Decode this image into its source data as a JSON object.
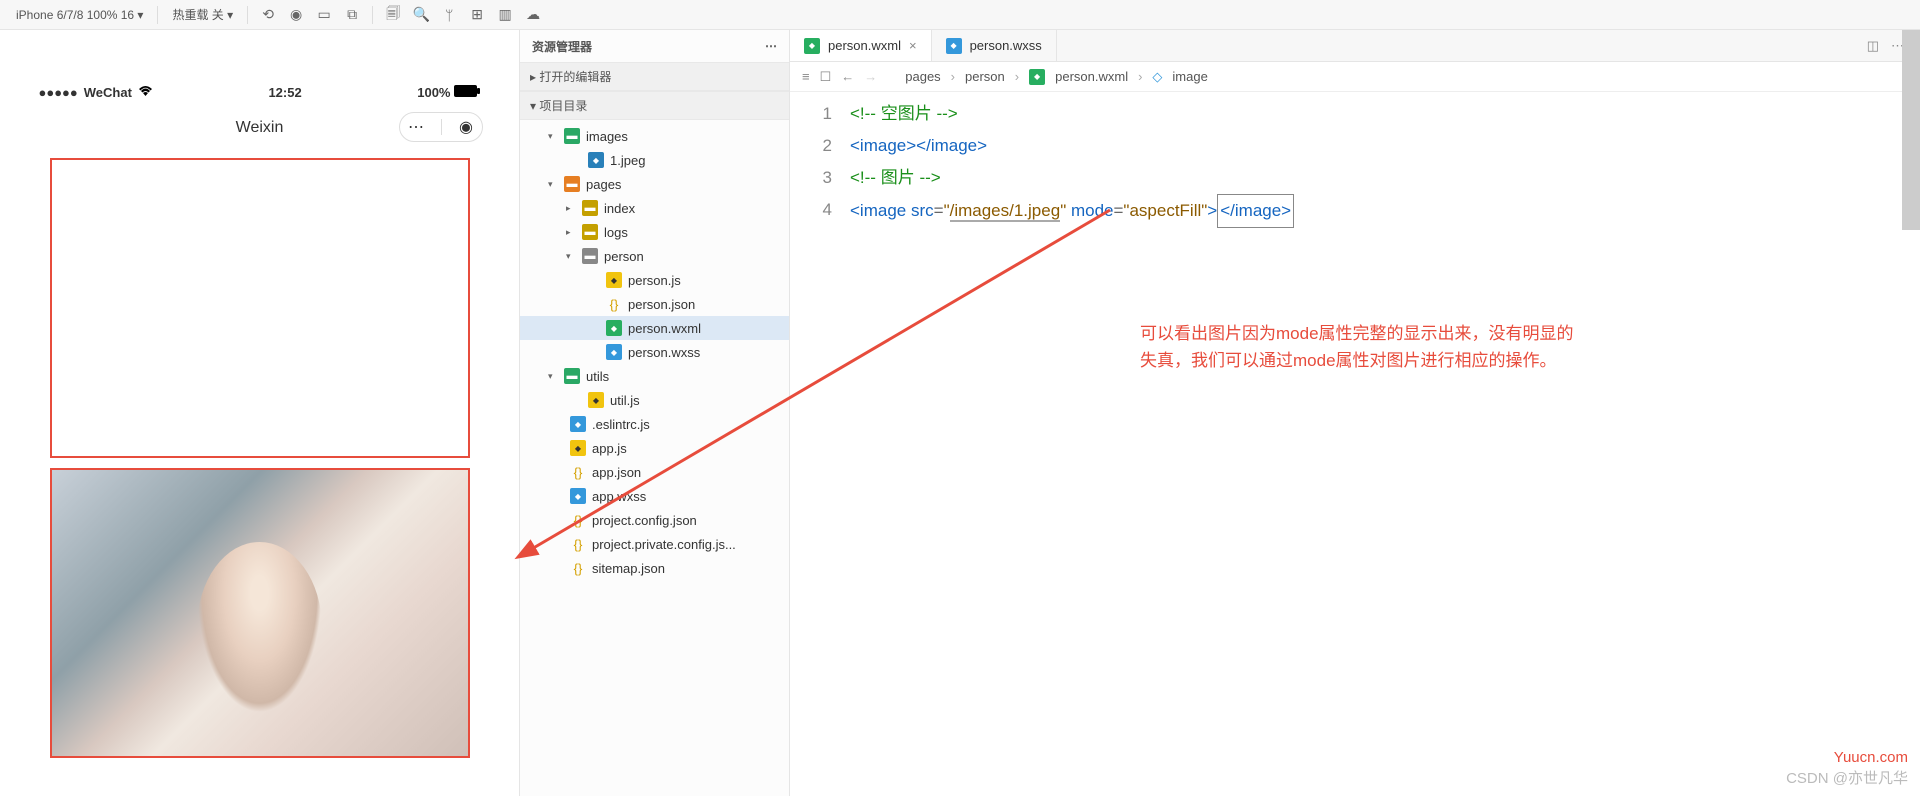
{
  "toolbar": {
    "device": "iPhone 6/7/8 100% 16 ▾",
    "hotreload": "热重载 关 ▾"
  },
  "simulator": {
    "status": {
      "carrier": "WeChat",
      "time": "12:52",
      "battery": "100%"
    },
    "nav_title": "Weixin"
  },
  "explorer": {
    "title": "资源管理器",
    "open_editors": "▸ 打开的编辑器",
    "project_dir": "▾ 项目目录",
    "tree": [
      {
        "indent": 28,
        "chev": "▾",
        "icon": "ic-folder-g",
        "label": "images"
      },
      {
        "indent": 52,
        "chev": "",
        "icon": "ic-img",
        "label": "1.jpeg"
      },
      {
        "indent": 28,
        "chev": "▾",
        "icon": "ic-folder-o",
        "label": "pages"
      },
      {
        "indent": 46,
        "chev": "▸",
        "icon": "ic-folder-y",
        "label": "index"
      },
      {
        "indent": 46,
        "chev": "▸",
        "icon": "ic-folder-y",
        "label": "logs"
      },
      {
        "indent": 46,
        "chev": "▾",
        "icon": "ic-folder-gr",
        "label": "person"
      },
      {
        "indent": 70,
        "chev": "",
        "icon": "ic-js",
        "label": "person.js"
      },
      {
        "indent": 70,
        "chev": "",
        "icon": "ic-json",
        "label": "person.json"
      },
      {
        "indent": 70,
        "chev": "",
        "icon": "ic-wxml",
        "label": "person.wxml",
        "selected": true
      },
      {
        "indent": 70,
        "chev": "",
        "icon": "ic-wxss",
        "label": "person.wxss"
      },
      {
        "indent": 28,
        "chev": "▾",
        "icon": "ic-folder-g",
        "label": "utils"
      },
      {
        "indent": 52,
        "chev": "",
        "icon": "ic-js",
        "label": "util.js"
      },
      {
        "indent": 34,
        "chev": "",
        "icon": "ic-wxss",
        "label": ".eslintrc.js"
      },
      {
        "indent": 34,
        "chev": "",
        "icon": "ic-js",
        "label": "app.js"
      },
      {
        "indent": 34,
        "chev": "",
        "icon": "ic-json",
        "label": "app.json"
      },
      {
        "indent": 34,
        "chev": "",
        "icon": "ic-wxss",
        "label": "app.wxss"
      },
      {
        "indent": 34,
        "chev": "",
        "icon": "ic-json",
        "label": "project.config.json"
      },
      {
        "indent": 34,
        "chev": "",
        "icon": "ic-json",
        "label": "project.private.config.js..."
      },
      {
        "indent": 34,
        "chev": "",
        "icon": "ic-json",
        "label": "sitemap.json"
      }
    ]
  },
  "tabs": [
    {
      "icon": "ic-wxml",
      "label": "person.wxml",
      "active": true
    },
    {
      "icon": "ic-wxss",
      "label": "person.wxss",
      "active": false
    }
  ],
  "breadcrumb": {
    "items": [
      "pages",
      "person"
    ],
    "file": "person.wxml",
    "symbol": "image"
  },
  "editor": {
    "lines": [
      "1",
      "2",
      "3",
      "4"
    ]
  },
  "code": {
    "l1_comment_open": "<!--",
    "l1_comment_text": " 空图片 ",
    "l1_comment_close": "-->",
    "l2_open": "<image>",
    "l2_close": "</image>",
    "l3_comment_open": "<!--",
    "l3_comment_text": " 图片 ",
    "l3_comment_close": "-->",
    "l4_tag_open": "<image",
    "l4_attr_src": " src",
    "l4_eq1": "=",
    "l4_val_src_q": "\"",
    "l4_val_src": "/images/1.jpeg",
    "l4_attr_mode": " mode",
    "l4_eq2": "=",
    "l4_val_mode": "\"aspectFill\"",
    "l4_close1": ">",
    "l4_close_tag": "</image>"
  },
  "annotation": {
    "line1": "可以看出图片因为mode属性完整的显示出来，没有明显的",
    "line2": "失真，我们可以通过mode属性对图片进行相应的操作。"
  },
  "watermark": "Yuucn.com",
  "watermark2": "CSDN @亦世凡华"
}
